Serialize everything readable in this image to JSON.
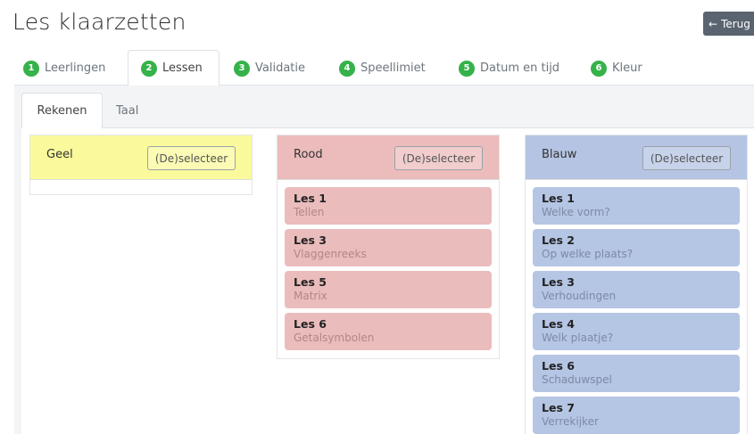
{
  "header": {
    "title": "Les klaarzetten",
    "back_label": "Terug"
  },
  "steps": [
    {
      "num": "1",
      "label": "Leerlingen"
    },
    {
      "num": "2",
      "label": "Lessen"
    },
    {
      "num": "3",
      "label": "Validatie"
    },
    {
      "num": "4",
      "label": "Speellimiet"
    },
    {
      "num": "5",
      "label": "Datum en tijd"
    },
    {
      "num": "6",
      "label": "Kleur"
    }
  ],
  "active_step": "Lessen",
  "subtabs": [
    "Rekenen",
    "Taal"
  ],
  "active_subtab": "Rekenen",
  "colors": {
    "step_badge": "#35b24a",
    "geel": "#fafa9c",
    "rood": "#ecbcbc",
    "blauw": "#b5c4e3"
  },
  "groups": {
    "geel": {
      "name": "Geel",
      "deselect_label": "(De)selecteer",
      "lessons": []
    },
    "rood": {
      "name": "Rood",
      "deselect_label": "(De)selecteer",
      "lessons": [
        {
          "title": "Les 1",
          "subtitle": "Tellen"
        },
        {
          "title": "Les 3",
          "subtitle": "Vlaggenreeks"
        },
        {
          "title": "Les 5",
          "subtitle": "Matrix"
        },
        {
          "title": "Les 6",
          "subtitle": "Getalsymbolen"
        }
      ]
    },
    "blauw": {
      "name": "Blauw",
      "deselect_label": "(De)selecteer",
      "lessons": [
        {
          "title": "Les 1",
          "subtitle": "Welke vorm?"
        },
        {
          "title": "Les 2",
          "subtitle": "Op welke plaats?"
        },
        {
          "title": "Les 3",
          "subtitle": "Verhoudingen"
        },
        {
          "title": "Les 4",
          "subtitle": "Welk plaatje?"
        },
        {
          "title": "Les 6",
          "subtitle": "Schaduwspel"
        },
        {
          "title": "Les 7",
          "subtitle": "Verrekijker"
        }
      ]
    }
  }
}
